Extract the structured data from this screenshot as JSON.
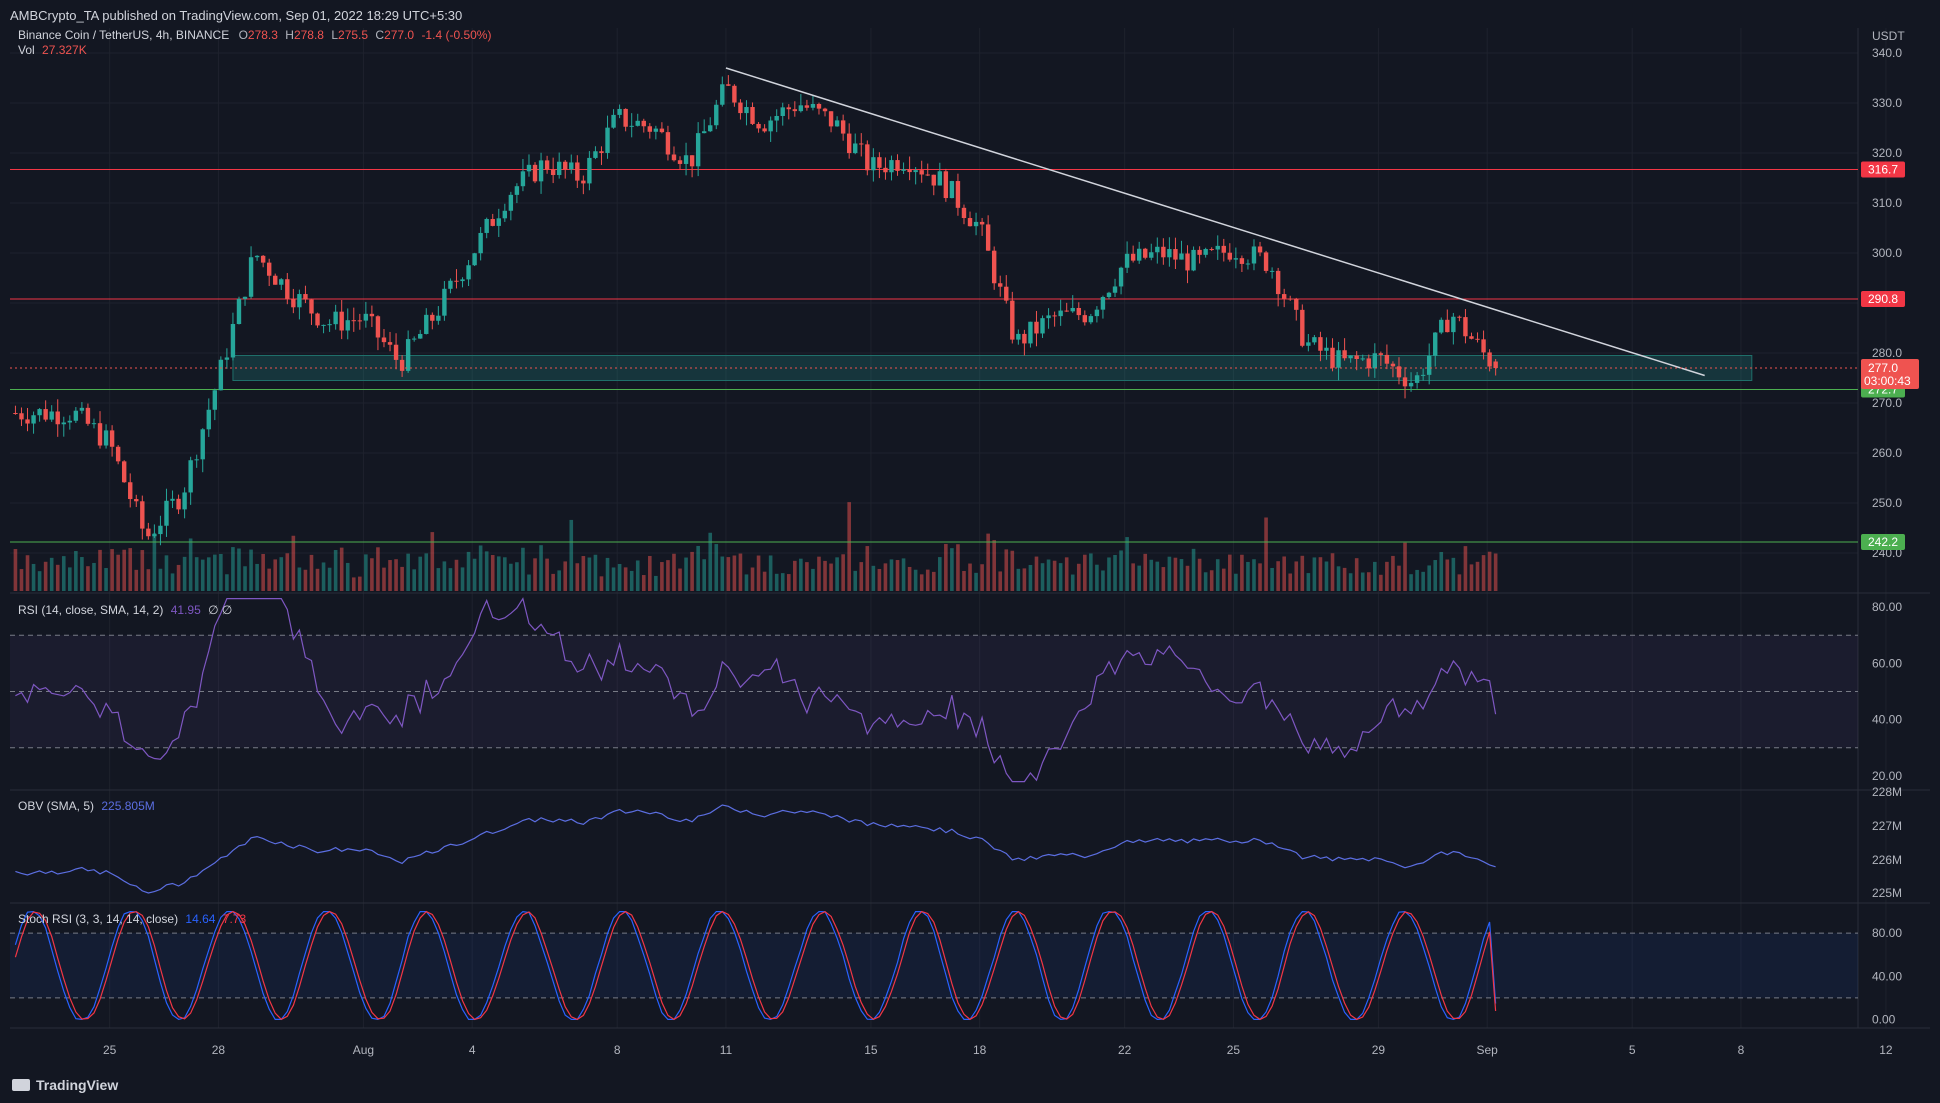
{
  "header": {
    "published_text": "AMBCrypto_TA published on TradingView.com, Sep 01, 2022 18:29 UTC+5:30"
  },
  "footer": {
    "brand": "TradingView"
  },
  "main_legend": {
    "symbol": "Binance Coin / TetherUS, 4h, BINANCE",
    "o_label": "O",
    "o": "278.3",
    "h_label": "H",
    "h": "278.8",
    "l_label": "L",
    "l": "275.5",
    "c_label": "C",
    "c": "277.0",
    "change": "-1.4 (-0.50%)",
    "vol_label": "Vol",
    "vol": "27.327K"
  },
  "rsi_legend": {
    "label": "RSI (14, close, SMA, 14, 2)",
    "value": "41.95",
    "extra": "∅ ∅"
  },
  "obv_legend": {
    "label": "OBV (SMA, 5)",
    "value": "225.805M"
  },
  "stoch_legend": {
    "label": "Stoch RSI (3, 3, 14, 14, close)",
    "k": "14.64",
    "d": "7.73"
  },
  "colors": {
    "bg": "#131722",
    "up": "#26a69a",
    "down": "#ef5350",
    "rsi": "#7e57c2",
    "obv": "#5b6ee1",
    "stoch_k": "#2962ff",
    "stoch_d": "#f23645",
    "resistance": "#f23645",
    "support": "#4caf50",
    "zone": "#1c3b4a",
    "trendline": "#d1d4dc"
  },
  "chart_data": [
    {
      "type": "candlestick",
      "pair": "Binance Coin / TetherUS",
      "timeframe": "4h",
      "exchange": "BINANCE",
      "currency_label": "USDT",
      "ylim": [
        232,
        345
      ],
      "y_ticks": [
        "340.0",
        "330.0",
        "320.0",
        "310.0",
        "300.0",
        "290.0",
        "280.0",
        "270.0",
        "260.0",
        "250.0",
        "240.0"
      ],
      "x_ticks": [
        "25",
        "28",
        "Aug",
        "4",
        "8",
        "11",
        "15",
        "18",
        "22",
        "25",
        "29",
        "Sep",
        "5",
        "8",
        "12"
      ],
      "horizontal_levels": [
        {
          "value": 316.7,
          "label": "316.7",
          "role": "resistance"
        },
        {
          "value": 290.8,
          "label": "290.8",
          "role": "resistance"
        },
        {
          "value": 272.7,
          "label": "272.7",
          "role": "support"
        },
        {
          "value": 242.2,
          "label": "242.2",
          "role": "support"
        }
      ],
      "current_price": {
        "value": 277.0,
        "label": "277.0",
        "countdown": "03:00:43"
      },
      "support_zone": {
        "low": 274.5,
        "high": 279.5
      },
      "trendline": {
        "from": {
          "date": "Aug 11",
          "price": 337
        },
        "to": {
          "date": "Sep 7",
          "price": 275.5
        }
      },
      "price_path": [
        {
          "date": "Jul 24",
          "price": 268
        },
        {
          "date": "Jul 25",
          "price": 262
        },
        {
          "date": "Jul 26",
          "price": 243
        },
        {
          "date": "Jul 27",
          "price": 252
        },
        {
          "date": "Jul 28",
          "price": 275
        },
        {
          "date": "Jul 29",
          "price": 300
        },
        {
          "date": "Jul 30",
          "price": 292
        },
        {
          "date": "Jul 31",
          "price": 286
        },
        {
          "date": "Aug 1",
          "price": 287
        },
        {
          "date": "Aug 2",
          "price": 278
        },
        {
          "date": "Aug 3",
          "price": 288
        },
        {
          "date": "Aug 4",
          "price": 300
        },
        {
          "date": "Aug 5",
          "price": 312
        },
        {
          "date": "Aug 6",
          "price": 318
        },
        {
          "date": "Aug 7",
          "price": 315
        },
        {
          "date": "Aug 8",
          "price": 327
        },
        {
          "date": "Aug 9",
          "price": 325
        },
        {
          "date": "Aug 10",
          "price": 318
        },
        {
          "date": "Aug 11",
          "price": 333
        },
        {
          "date": "Aug 12",
          "price": 326
        },
        {
          "date": "Aug 13",
          "price": 330
        },
        {
          "date": "Aug 14",
          "price": 326
        },
        {
          "date": "Aug 15",
          "price": 317
        },
        {
          "date": "Aug 16",
          "price": 319
        },
        {
          "date": "Aug 17",
          "price": 314
        },
        {
          "date": "Aug 18",
          "price": 305
        },
        {
          "date": "Aug 19",
          "price": 282
        },
        {
          "date": "Aug 20",
          "price": 287
        },
        {
          "date": "Aug 21",
          "price": 288
        },
        {
          "date": "Aug 22",
          "price": 298
        },
        {
          "date": "Aug 23",
          "price": 300
        },
        {
          "date": "Aug 24",
          "price": 298
        },
        {
          "date": "Aug 25",
          "price": 301
        },
        {
          "date": "Aug 26",
          "price": 298
        },
        {
          "date": "Aug 27",
          "price": 282
        },
        {
          "date": "Aug 28",
          "price": 278
        },
        {
          "date": "Aug 29",
          "price": 279
        },
        {
          "date": "Aug 30",
          "price": 274
        },
        {
          "date": "Aug 31",
          "price": 288
        },
        {
          "date": "Sep 1",
          "price": 279
        },
        {
          "date": "Sep 1",
          "price": 277
        }
      ]
    },
    {
      "type": "bar",
      "name": "Vol",
      "value_label": "27.327K"
    },
    {
      "type": "line",
      "name": "RSI (14, close, SMA, 14, 2)",
      "value": 41.95,
      "ylim": [
        15,
        85
      ],
      "y_ticks": [
        "80.00",
        "60.00",
        "40.00",
        "20.00"
      ],
      "bands": [
        30,
        50,
        70
      ]
    },
    {
      "type": "line",
      "name": "OBV (SMA, 5)",
      "value_label": "225.805M",
      "y_ticks": [
        "228M",
        "227M",
        "226M",
        "225M"
      ]
    },
    {
      "type": "line",
      "name": "Stoch RSI (3, 3, 14, 14, close)",
      "k": 14.64,
      "d": 7.73,
      "ylim": [
        -8,
        108
      ],
      "y_ticks": [
        "80.00",
        "40.00",
        "0.00"
      ],
      "bands": [
        20,
        80
      ]
    }
  ]
}
